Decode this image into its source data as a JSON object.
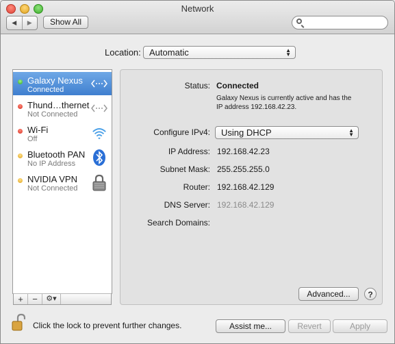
{
  "window": {
    "title": "Network"
  },
  "toolbar": {
    "back_label": "◀",
    "forward_label": "▶",
    "show_all_label": "Show All",
    "search": {
      "placeholder": "",
      "icon": "search-icon"
    }
  },
  "location": {
    "label": "Location:",
    "value": "Automatic"
  },
  "sidebar": {
    "services": [
      {
        "name": "Galaxy Nexus",
        "status": "Connected",
        "status_color": "green",
        "icon": "usb-ethernet-icon",
        "selected": true
      },
      {
        "name": "Thund…thernet",
        "status": "Not Connected",
        "status_color": "red",
        "icon": "ethernet-icon",
        "selected": false
      },
      {
        "name": "Wi-Fi",
        "status": "Off",
        "status_color": "red",
        "icon": "wifi-icon",
        "selected": false
      },
      {
        "name": "Bluetooth PAN",
        "status": "No IP Address",
        "status_color": "yellow",
        "icon": "bluetooth-icon",
        "selected": false
      },
      {
        "name": "NVIDIA VPN",
        "status": "Not Connected",
        "status_color": "yellow",
        "icon": "vpn-lock-icon",
        "selected": false
      }
    ],
    "add_label": "+",
    "remove_label": "−",
    "gear_label": "⚙▾"
  },
  "detail": {
    "status_label": "Status:",
    "status_value": "Connected",
    "status_desc_line1": "Galaxy Nexus is currently active and has the",
    "status_desc_line2": "IP address 192.168.42.23.",
    "configure_label": "Configure IPv4:",
    "configure_value": "Using DHCP",
    "ip_label": "IP Address:",
    "ip_value": "192.168.42.23",
    "subnet_label": "Subnet Mask:",
    "subnet_value": "255.255.255.0",
    "router_label": "Router:",
    "router_value": "192.168.42.129",
    "dns_label": "DNS Server:",
    "dns_value": "192.168.42.129",
    "search_domains_label": "Search Domains:",
    "advanced_label": "Advanced...",
    "help_label": "?"
  },
  "footer": {
    "lock_text": "Click the lock to prevent further changes.",
    "assist_label": "Assist me...",
    "revert_label": "Revert",
    "apply_label": "Apply"
  },
  "colors": {
    "selection": "#3f7fcf",
    "connected": "#2fa81e",
    "disconnected": "#d62d20",
    "warning": "#e0a31c"
  }
}
